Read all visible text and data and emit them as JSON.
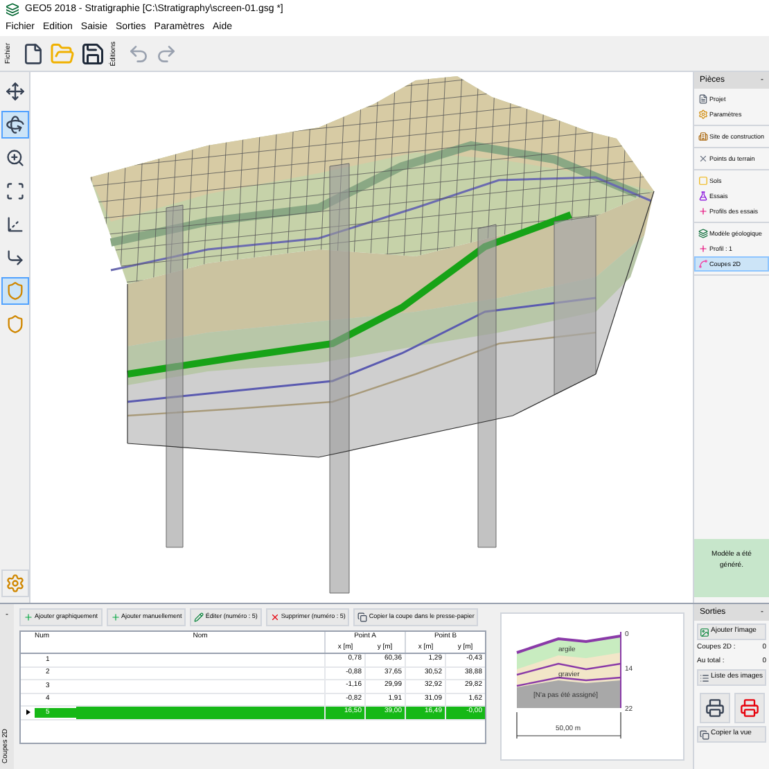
{
  "window": {
    "title": "GEO5 2018 - Stratigraphie [C:\\Stratigraphy\\screen-01.gsg *]"
  },
  "menu": [
    "Fichier",
    "Edition",
    "Saisie",
    "Sorties",
    "Paramètres",
    "Aide"
  ],
  "toolbar": {
    "file_label": "Fichier",
    "edit_label": "Éditions"
  },
  "tools": [
    {
      "kind": "move",
      "selected": false
    },
    {
      "kind": "rotate",
      "selected": true
    },
    {
      "kind": "zoom",
      "selected": false
    },
    {
      "kind": "fit",
      "selected": false
    },
    {
      "kind": "axes3d",
      "selected": false
    },
    {
      "kind": "axes2d",
      "selected": false
    },
    {
      "kind": "shield",
      "selected": true
    },
    {
      "kind": "shield",
      "selected": false
    }
  ],
  "pieces": {
    "title": "Pièces",
    "collapse": "-",
    "groups": [
      [
        {
          "kind": "project",
          "label": "Projet",
          "selected": false
        },
        {
          "kind": "settings",
          "label": "Paramètres",
          "selected": false
        }
      ],
      [
        {
          "kind": "site",
          "label": "Site de construction",
          "selected": false
        }
      ],
      [
        {
          "kind": "points",
          "label": "Points du terrain",
          "selected": false
        }
      ],
      [
        {
          "kind": "soil",
          "label": "Sols",
          "selected": false
        },
        {
          "kind": "test",
          "label": "Essais",
          "selected": false
        },
        {
          "kind": "profile",
          "label": "Profils des essais",
          "selected": false
        }
      ],
      [
        {
          "kind": "model",
          "label": "Modèle géologique",
          "selected": false
        },
        {
          "kind": "profile",
          "label": "Profil : 1",
          "selected": false
        },
        {
          "kind": "section",
          "label": "Coupes 2D",
          "selected": true
        }
      ]
    ],
    "notice": "Modèle a été généré."
  },
  "coupes": {
    "tab_label": "Coupes 2D",
    "collapse": "-",
    "actions": [
      {
        "kind": "add-graphic",
        "label": "Ajouter graphiquement"
      },
      {
        "kind": "add-manual",
        "label": "Ajouter manuellement"
      },
      {
        "kind": "edit",
        "label": "Éditer (numéro : 5)"
      },
      {
        "kind": "delete",
        "label": "Supprimer (numéro : 5)"
      },
      {
        "kind": "copy",
        "label": "Copier la coupe dans le presse-papier"
      }
    ],
    "table": {
      "columns": [
        "Num",
        "Nom"
      ],
      "group_columns": [
        "Point A",
        "Point B"
      ],
      "sub_columns": [
        "x [m]",
        "y [m]",
        "x [m]",
        "y [m]"
      ],
      "rows": [
        {
          "num": "1",
          "values": [
            "0,78",
            "60,36",
            "1,29",
            "-0,43"
          ],
          "selected": false
        },
        {
          "num": "2",
          "values": [
            "-0,88",
            "37,65",
            "30,52",
            "38,88"
          ],
          "selected": false
        },
        {
          "num": "3",
          "values": [
            "-1,16",
            "29,99",
            "32,92",
            "29,82"
          ],
          "selected": false
        },
        {
          "num": "4",
          "values": [
            "-0,82",
            "1,91",
            "31,09",
            "1,62"
          ],
          "selected": false
        },
        {
          "num": "5",
          "values": [
            "16,50",
            "39,00",
            "16,49",
            "-0,00"
          ],
          "selected": true
        }
      ]
    }
  },
  "preview": {
    "layer_labels": [
      "argile",
      "gravier",
      "[N'a pas été assigné]"
    ],
    "depth_labels": [
      "0",
      "14",
      "22"
    ],
    "length": "50,00 m"
  },
  "sorties": {
    "title": "Sorties",
    "collapse": "-",
    "add_image": "Ajouter l'image",
    "stats": [
      {
        "label": "Coupes 2D :",
        "value": "0"
      },
      {
        "label": "Au total :",
        "value": "0"
      }
    ],
    "list_images": "Liste des images",
    "print_buttons": [
      {
        "kind": "print"
      },
      {
        "kind": "print-pdf"
      }
    ],
    "copy_view": "Copier la vue"
  }
}
